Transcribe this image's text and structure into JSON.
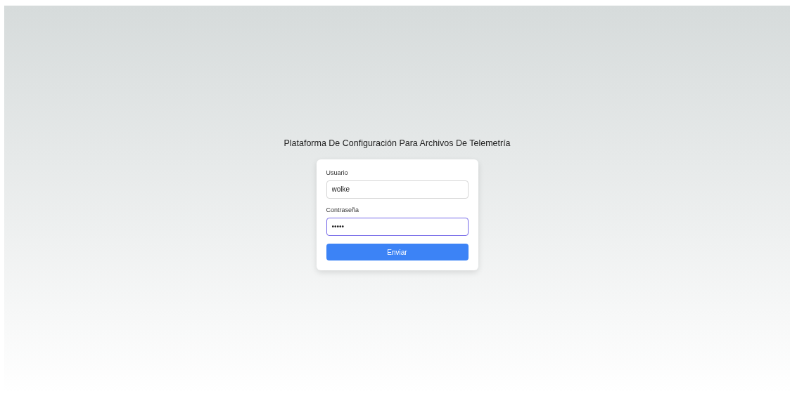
{
  "title": "Plataforma De Configuración Para Archivos De Telemetría",
  "form": {
    "fields": [
      {
        "label": "Usuario",
        "value": "wolke",
        "focused": false
      },
      {
        "label": "Contraseña",
        "value": "•••••",
        "focused": true
      }
    ],
    "submit": "Enviar"
  }
}
